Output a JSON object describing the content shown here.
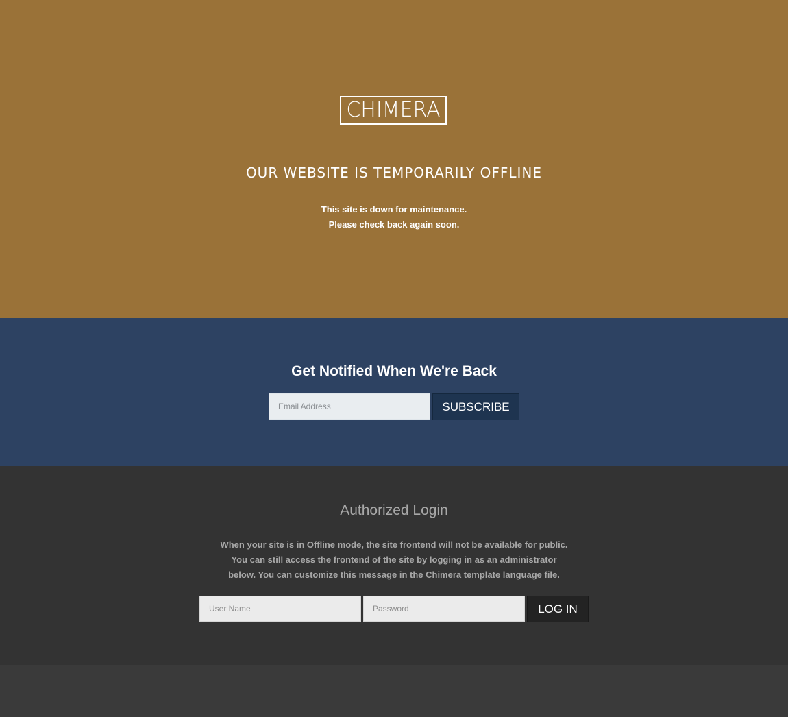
{
  "hero": {
    "logo_text": "CHIMERA",
    "headline": "OUR WEBSITE IS TEMPORARILY OFFLINE",
    "message_line1": "This site is down for maintenance.",
    "message_line2": "Please check back again soon."
  },
  "notify": {
    "title": "Get Notified When We're Back",
    "email_placeholder": "Email Address",
    "subscribe_label": "SUBSCRIBE"
  },
  "login": {
    "title": "Authorized Login",
    "description": "When your site is in Offline mode, the site frontend will not be available for public. You can still access the frontend of the site by logging in as an administrator below. You can customize this message in the Chimera template language file.",
    "username_placeholder": "User Name",
    "password_placeholder": "Password",
    "login_label": "LOG IN"
  },
  "colors": {
    "hero_bg": "#9a7238",
    "notify_bg": "#2d4262",
    "login_bg": "#333333",
    "footer_bg": "#3a3a3a",
    "subscribe_bg": "#1e3450",
    "login_btn_bg": "#232323"
  }
}
